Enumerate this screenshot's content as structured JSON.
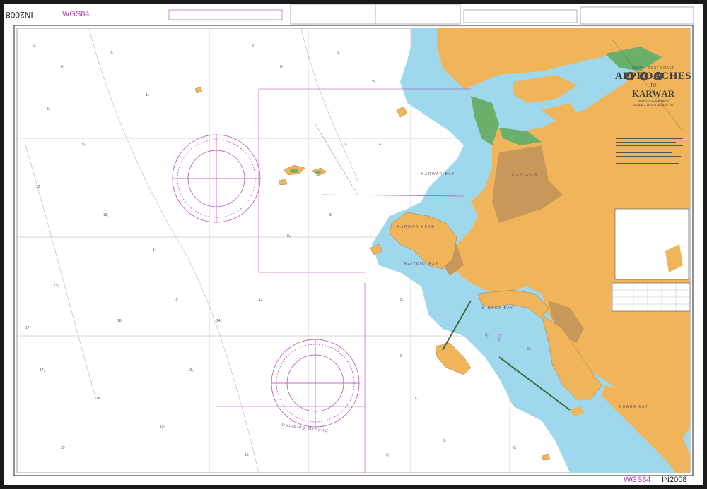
{
  "chart_number": "IN2008",
  "datum": "WGS84",
  "title": {
    "region": "INDIA · WEST COAST",
    "main": "APPROACHES",
    "connector": "TO",
    "place": "KĀRWĀR",
    "depths": "DEPTHS IN METRES",
    "scale": "SCALE 1:25 000 at lat 17°30'"
  },
  "place_names": {
    "karwar_bay": "KARWAR BAY",
    "karwar_head": "KARWAR HEAD",
    "baitkol_bay": "BAITKOL BAY",
    "karwar_town": "KARWAR",
    "khada_bay": "KHADA BAY",
    "binaga_bay": "BINAGA BAY",
    "dumping_ground": "Dumping Ground"
  },
  "colors": {
    "land": "#f0b55a",
    "built_up": "#c8975a",
    "shallow_water": "#9fd8ec",
    "drying": "#6ab06a",
    "magenta": "#b03cb4",
    "background_water": "#ffffff"
  },
  "icons": [
    "compass-rose-icon",
    "compass-rose-icon",
    "crest-icon",
    "crest-icon",
    "crest-icon"
  ]
}
